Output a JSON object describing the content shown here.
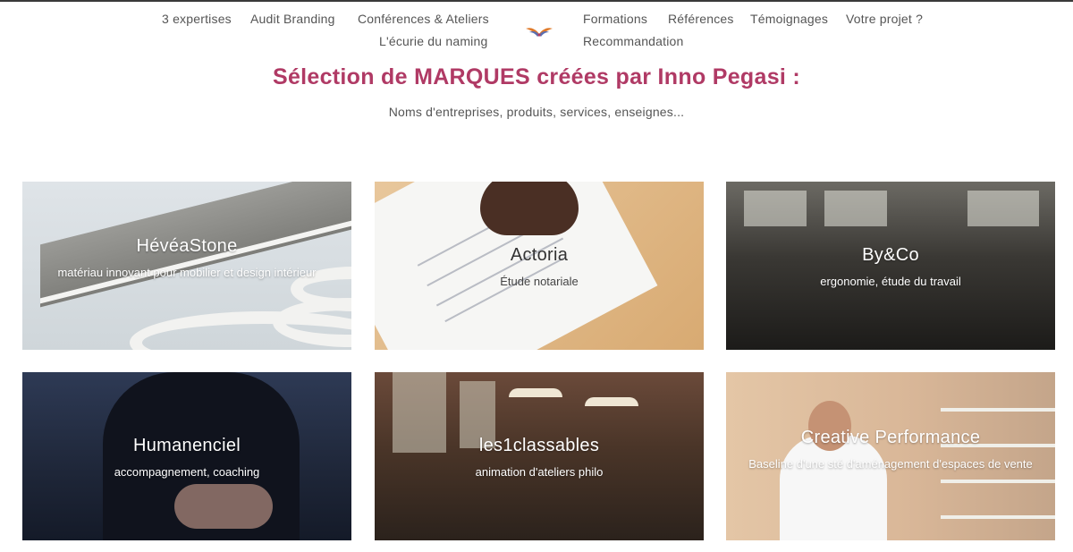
{
  "nav": {
    "left_row1": [
      "3 expertises",
      "Audit Branding",
      "Conférences & Ateliers"
    ],
    "left_row2": [
      "L'écurie du naming"
    ],
    "right_row1": [
      "Formations",
      "Références",
      "Témoignages",
      "Votre projet ?"
    ],
    "right_row2": [
      "Recommandation"
    ]
  },
  "page": {
    "heading": "Sélection de MARQUES créées par Inno Pegasi :",
    "subheading": "Noms d'entreprises, produits, services, enseignes..."
  },
  "cards": [
    {
      "title": "HévéaStone",
      "description": "matériau innovant pour mobilier et design intérieur"
    },
    {
      "title": "Actoria",
      "description": "Étude notariale"
    },
    {
      "title": "By&Co",
      "description": "ergonomie, étude du travail"
    },
    {
      "title": "Humanenciel",
      "description": "accompagnement, coaching"
    },
    {
      "title": "les1classables",
      "description": "animation d'ateliers philo"
    },
    {
      "title": "Creative Performance",
      "description": "Baseline d'une sté d'aménagement d'espaces de vente"
    }
  ],
  "colors": {
    "accent": "#b03a65",
    "nav_text": "#555555"
  },
  "icons": {
    "logo": "pegasus-wings-logo"
  }
}
